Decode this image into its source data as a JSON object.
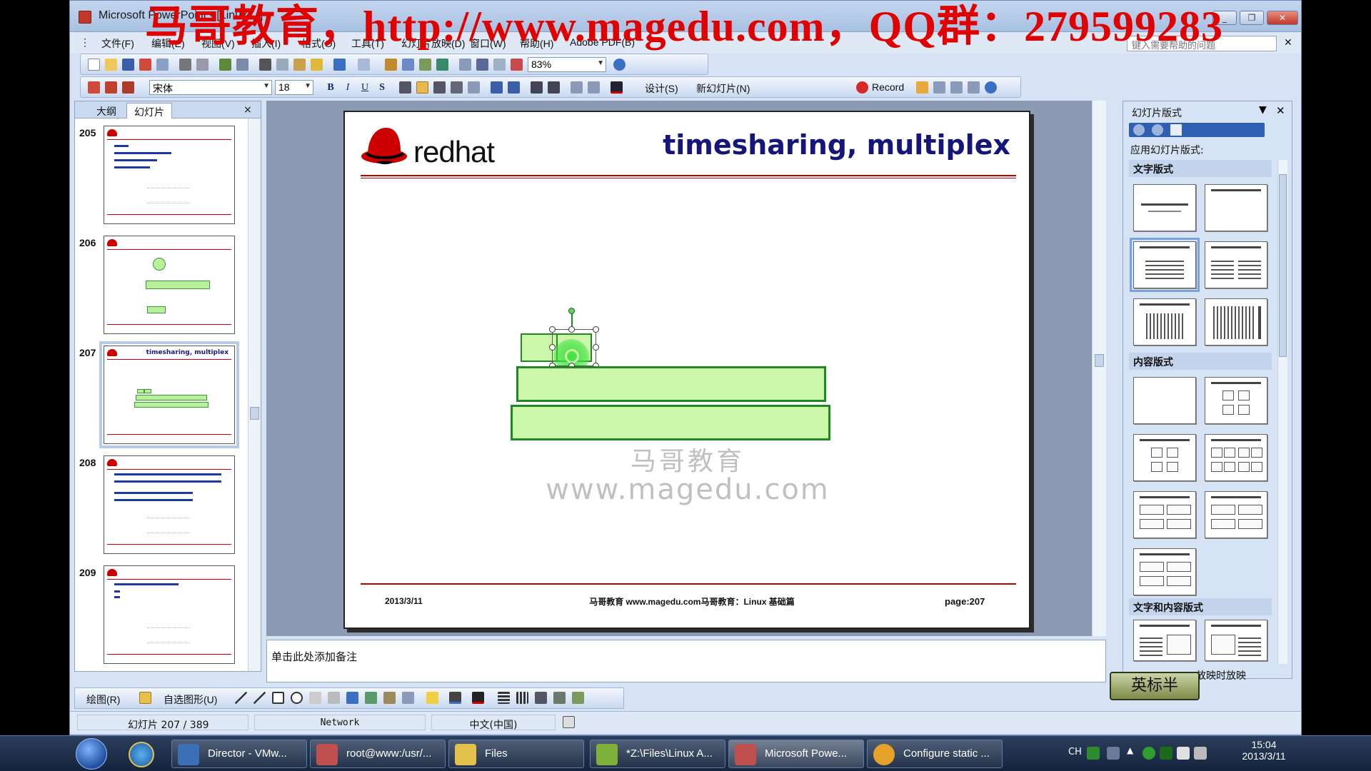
{
  "window": {
    "title": "Microsoft PowerPoint - [Linux ...]",
    "watermark": "马哥教育，http://www.magedu.com，QQ群：279599283",
    "help_box_placeholder": "键入需要帮助的问题",
    "controls": [
      "_",
      "❐",
      "✕"
    ]
  },
  "menubar": {
    "items": [
      "文件(F)",
      "编辑(E)",
      "视图(V)",
      "插入(I)",
      "格式(O)",
      "工具(T)",
      "幻灯片放映(D)",
      "窗口(W)",
      "帮助(H)",
      "Adobe PDF(B)"
    ],
    "close": "✕"
  },
  "toolbar1": {
    "zoom": "83%"
  },
  "toolbar2": {
    "font_name": "宋体",
    "font_size": "18",
    "format_buttons": [
      "B",
      "I",
      "U",
      "S"
    ],
    "design_label": "设计(S)",
    "new_slide_label": "新幻灯片(N)",
    "record_label": "Record"
  },
  "left_pane": {
    "tab_outline": "大纲",
    "tab_slides": "幻灯片",
    "close": "×",
    "thumbs": [
      {
        "num": "205",
        "kind": "bullets"
      },
      {
        "num": "206",
        "kind": "diagram"
      },
      {
        "num": "207",
        "kind": "current",
        "title": "timesharing, multiplex"
      },
      {
        "num": "208",
        "kind": "bullets"
      },
      {
        "num": "209",
        "kind": "bullets"
      }
    ]
  },
  "slide": {
    "logo_text": "redhat",
    "title": "timesharing, multiplex",
    "watermark_line1": "马哥教育",
    "watermark_line2": "www.magedu.com",
    "footer_date": "2013/3/11",
    "footer_center": "马哥教育 www.magedu.com马哥教育：Linux 基础篇",
    "footer_page": "page:207"
  },
  "notes": {
    "placeholder": "单击此处添加备注"
  },
  "task_pane": {
    "title": "幻灯片版式",
    "apply_label": "应用幻灯片版式:",
    "section_text": "文字版式",
    "section_content": "内容版式",
    "section_text_content": "文字和内容版式",
    "footer_label": "放映时放映"
  },
  "drawbar": {
    "draw_label": "绘图(R)",
    "autoshape_label": "自选图形(U)"
  },
  "statusbar": {
    "slide_info": "幻灯片 207 / 389",
    "design": "Network",
    "language": "中文(中国)"
  },
  "ime": {
    "label": "英标半"
  },
  "taskbar": {
    "buttons": [
      {
        "label": "Director - VMw...",
        "color": "#3b6fb6"
      },
      {
        "label": "root@www:/usr/...",
        "color": "#c0504d"
      },
      {
        "label": "Files",
        "color": "#e3c14b"
      },
      {
        "label": "*Z:\\Files\\Linux A...",
        "color": "#7fb03a"
      },
      {
        "label": "Microsoft Powe...",
        "color": "#c0504d"
      },
      {
        "label": "Configure static ...",
        "color": "#e5a128"
      }
    ],
    "lang": "CH",
    "time": "15:04",
    "date": "2013/3/11"
  }
}
